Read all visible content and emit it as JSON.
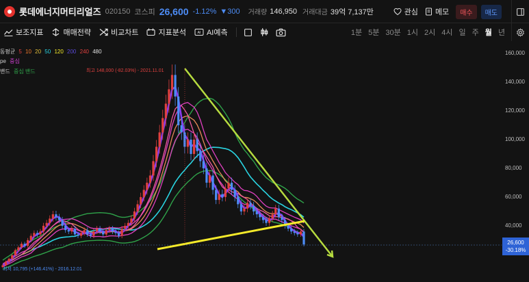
{
  "header": {
    "name": "롯데에너지머티리얼즈",
    "code": "020150",
    "market": "코스피",
    "price": "26,600",
    "change_pct": "-1.12%",
    "change_abs": "▼300",
    "volume_label": "거래량",
    "volume": "146,950",
    "amount_label": "거래대금",
    "amount": "39억 7,137만",
    "watch_label": "관심",
    "memo_label": "메모",
    "buy_label": "매수",
    "sell_label": "매도"
  },
  "toolbar": {
    "tools": [
      {
        "label": "보조지표",
        "icon": "indicator-icon"
      },
      {
        "label": "매매전략",
        "icon": "strategy-icon"
      },
      {
        "label": "비교차트",
        "icon": "compare-icon"
      },
      {
        "label": "지표분석",
        "icon": "analysis-icon"
      },
      {
        "label": "AI예측",
        "icon": "ai-icon"
      }
    ],
    "periods": [
      "1분",
      "5분",
      "30분",
      "1시",
      "2시",
      "4시",
      "일",
      "주",
      "월",
      "년"
    ],
    "active_period": "월"
  },
  "indicators": {
    "ma": {
      "label": "동평균",
      "periods": [
        {
          "label": "5",
          "color": "#e0403f"
        },
        {
          "label": "10",
          "color": "#f07a2a"
        },
        {
          "label": "20",
          "color": "#e3c13b"
        },
        {
          "label": "50",
          "color": "#2ad4e2"
        },
        {
          "label": "120",
          "color": "#f4ea2a"
        },
        {
          "label": "200",
          "color": "#5a4ad8"
        },
        {
          "label": "240",
          "color": "#e0403f"
        },
        {
          "label": "480",
          "color": "#e0e0e0"
        }
      ]
    },
    "envelope": {
      "label": "pe",
      "mid_label": "중심",
      "colors": [
        "#cd3fd0"
      ]
    },
    "band": {
      "label": "밴드",
      "mid_label": "중심 밴드",
      "color": "#2fa34a"
    }
  },
  "colors": {
    "up": "#e0403f",
    "down": "#4d8cf5",
    "ma5": "#8a3cf0",
    "ma10": "#f05aa0",
    "ma20": "#e88a5a",
    "ma50": "#2ad4e2",
    "ma120": "#f4ea2a",
    "envelope": "#e040c0",
    "band": "#2fa34a",
    "trendline": "#b6db3f"
  },
  "chart_data": {
    "type": "candlestick",
    "interval": "월",
    "y_axis": {
      "ticks": [
        "160,000",
        "140,000",
        "120,000",
        "100,000",
        "80,000",
        "60,000",
        "40,000"
      ],
      "range": [
        20000,
        166000
      ]
    },
    "current_price": "26,600",
    "current_change": "-30.18%",
    "annotations": {
      "high": "최고 148,000 (-82.03%) - 2021.11.01",
      "low": "최저 10,795 (+146.41%) - 2016.12.01"
    },
    "x_range": [
      "2016.12",
      "2024.12"
    ],
    "series_note": "approximate monthly close values read from the chart",
    "closes": [
      12500,
      15000,
      17000,
      19500,
      23000,
      25000,
      27500,
      26000,
      30000,
      33000,
      35000,
      34000,
      36000,
      40000,
      42000,
      45000,
      48000,
      46000,
      44000,
      40000,
      37000,
      36000,
      38000,
      34000,
      33000,
      35000,
      37000,
      34000,
      33000,
      36000,
      38000,
      36000,
      34000,
      37000,
      38000,
      36000,
      35000,
      33000,
      38000,
      40000,
      42000,
      45000,
      50000,
      55000,
      60000,
      65000,
      70000,
      75000,
      85000,
      95000,
      105000,
      115000,
      125000,
      135000,
      145000,
      130000,
      110000,
      105000,
      95000,
      100000,
      90000,
      100000,
      92000,
      85000,
      80000,
      70000,
      75000,
      65000,
      58000,
      62000,
      60000,
      66000,
      70000,
      65000,
      60000,
      55000,
      50000,
      52000,
      56000,
      54000,
      50000,
      48000,
      46000,
      44000,
      42000,
      45000,
      48000,
      52000,
      46000,
      44000,
      40000,
      38000,
      36000,
      35000,
      34000,
      36000,
      27000
    ]
  }
}
